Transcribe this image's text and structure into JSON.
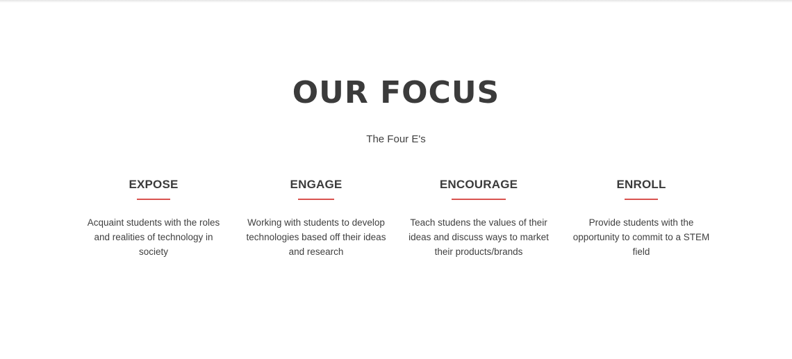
{
  "section": {
    "title": "OUR FOCUS",
    "subtitle": "The Four E's",
    "accent_color": "#d9534f"
  },
  "pillars": [
    {
      "heading": "EXPOSE",
      "description": "Acquaint students with the roles and realities of technology in society"
    },
    {
      "heading": "ENGAGE",
      "description": "Working with students to develop technologies based off their ideas and research"
    },
    {
      "heading": "ENCOURAGE",
      "description": "Teach studens the values of their ideas and discuss ways to market their products/brands"
    },
    {
      "heading": "ENROLL",
      "description": "Provide students with the opportunity to commit to a STEM field"
    }
  ]
}
